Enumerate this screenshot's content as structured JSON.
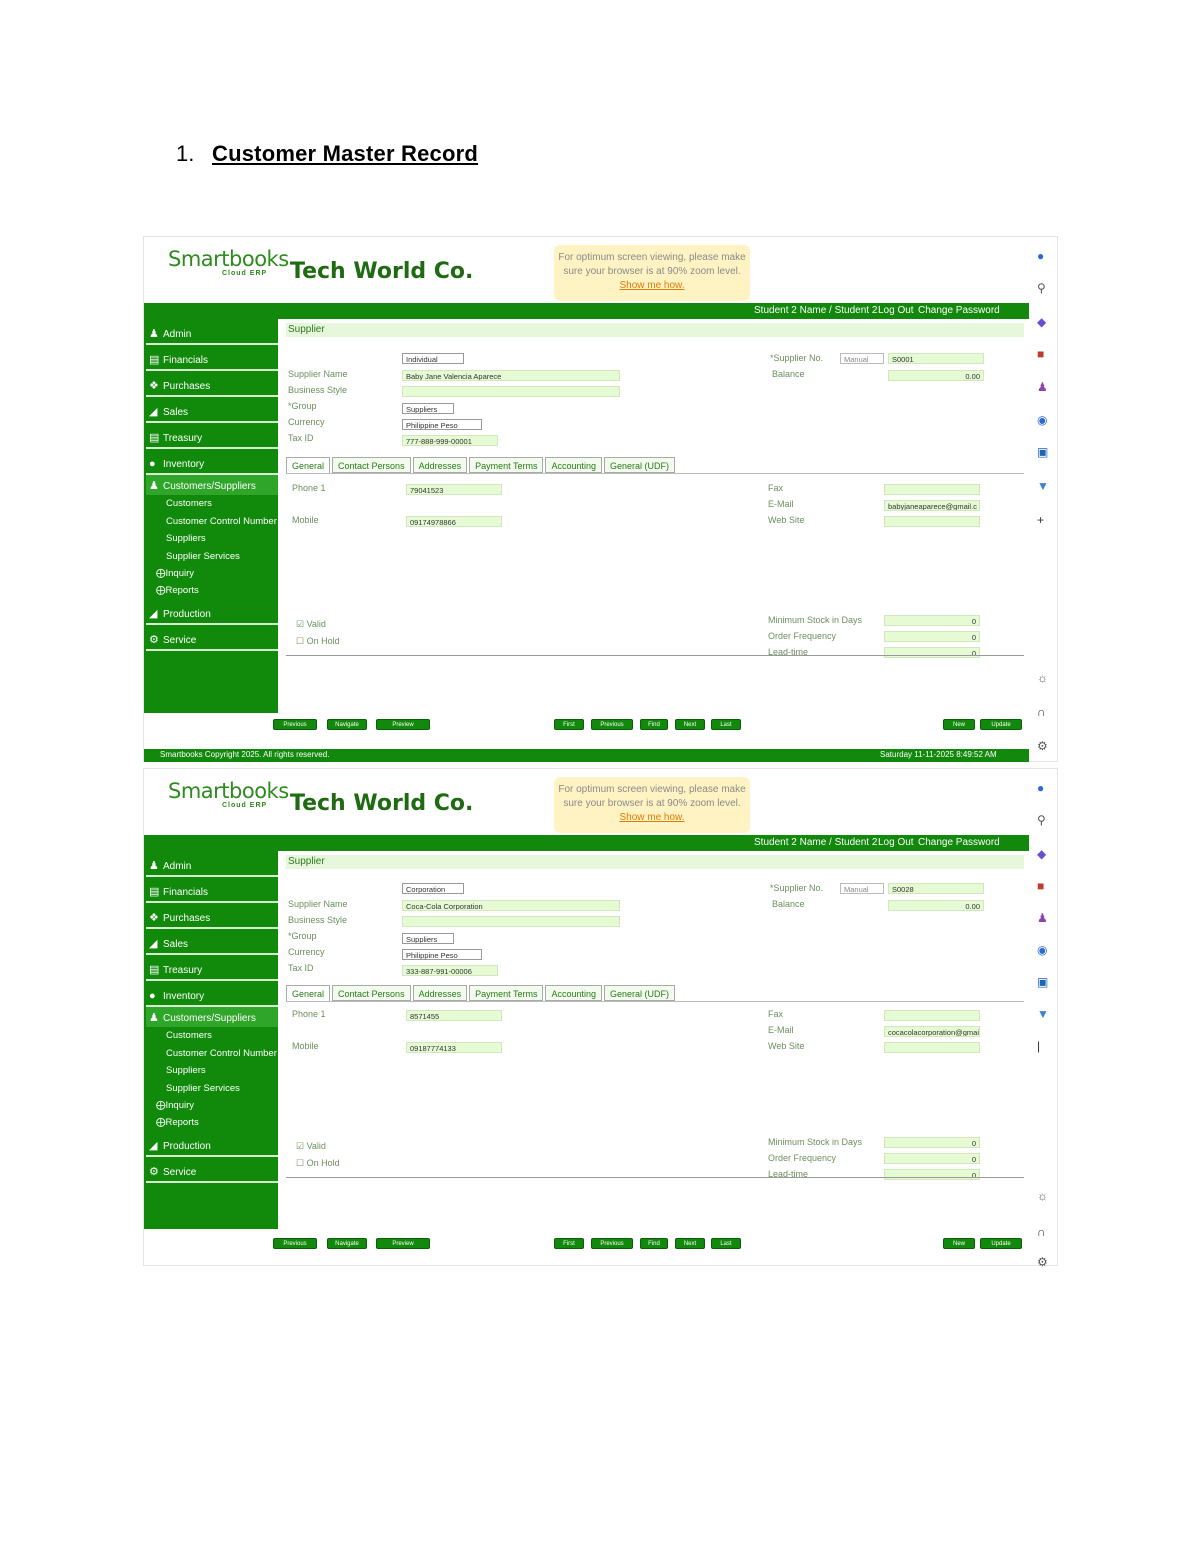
{
  "heading": {
    "number": "1.",
    "text": "Customer Master Record"
  },
  "app": {
    "logo_text": "Smartbooks",
    "logo_sub": "Cloud ERP",
    "company": "Tech World Co.",
    "notice_line1": "For optimum screen viewing, please make",
    "notice_line2": "sure your browser is at 90% zoom level.",
    "notice_link": "Show me how.",
    "user": "Student 2 Name / Student 2",
    "logout": "Log Out",
    "change_password": "Change Password",
    "footer_left": "Smartbooks Copyright 2025. All rights reserved.",
    "footer_right": "Saturday 11-11-2025 8:49:52 AM"
  },
  "nav": {
    "admin": "Admin",
    "financials": "Financials",
    "purchases": "Purchases",
    "sales": "Sales",
    "treasury": "Treasury",
    "inventory": "Inventory",
    "customers_suppliers": "Customers/Suppliers",
    "customers": "Customers",
    "customer_control_number": "Customer Control Number",
    "suppliers": "Suppliers",
    "supplier_services": "Supplier Services",
    "inquiry": "Inquiry",
    "reports": "Reports",
    "production": "Production",
    "service": "Service"
  },
  "labels": {
    "section": "Supplier",
    "supplier_name": "Supplier Name",
    "business_style": "Business Style",
    "group": "*Group",
    "currency": "Currency",
    "tax_id": "Tax ID",
    "supplier_no": "*Supplier No.",
    "balance": "Balance",
    "phone1": "Phone 1",
    "mobile": "Mobile",
    "fax": "Fax",
    "email": "E-Mail",
    "website": "Web Site",
    "valid": "Valid",
    "on_hold": "On Hold",
    "min_stock": "Minimum Stock in Days",
    "order_frequency": "Order Frequency",
    "lead_time": "Lead-time",
    "manual": "Manual"
  },
  "tabs": [
    "General",
    "Contact Persons",
    "Addresses",
    "Payment Terms",
    "Accounting",
    "General (UDF)"
  ],
  "buttons": {
    "bottom_left": [
      "Previous",
      "Navigate",
      "Preview"
    ],
    "nav": [
      "First",
      "Previous",
      "Find",
      "Next",
      "Last"
    ],
    "new": "New",
    "update": "Update"
  },
  "records": [
    {
      "type": "Individual",
      "supplier_name": "Baby Jane Valencia Aparece",
      "business_style": "",
      "group": "Suppliers",
      "currency": "Philippine Peso",
      "tax_id": "777-888-999-00001",
      "supplier_no": "S0001",
      "balance": "0.00",
      "phone1": "79041523",
      "mobile": "09174978866",
      "fax": "",
      "email": "babyjaneaparece@gmail.c",
      "website": "",
      "min_stock": "0",
      "order_frequency": "0",
      "lead_time": "0"
    },
    {
      "type": "Corporation",
      "supplier_name": "Coca-Cola Corporation",
      "business_style": "",
      "group": "Suppliers",
      "currency": "Philippine Peso",
      "tax_id": "333-887-991-00006",
      "supplier_no": "S0028",
      "balance": "0.00",
      "phone1": "8571455",
      "mobile": "09187774133",
      "fax": "",
      "email": "cocacolacorporation@gmail.",
      "website": "",
      "min_stock": "0",
      "order_frequency": "0",
      "lead_time": "0"
    }
  ]
}
